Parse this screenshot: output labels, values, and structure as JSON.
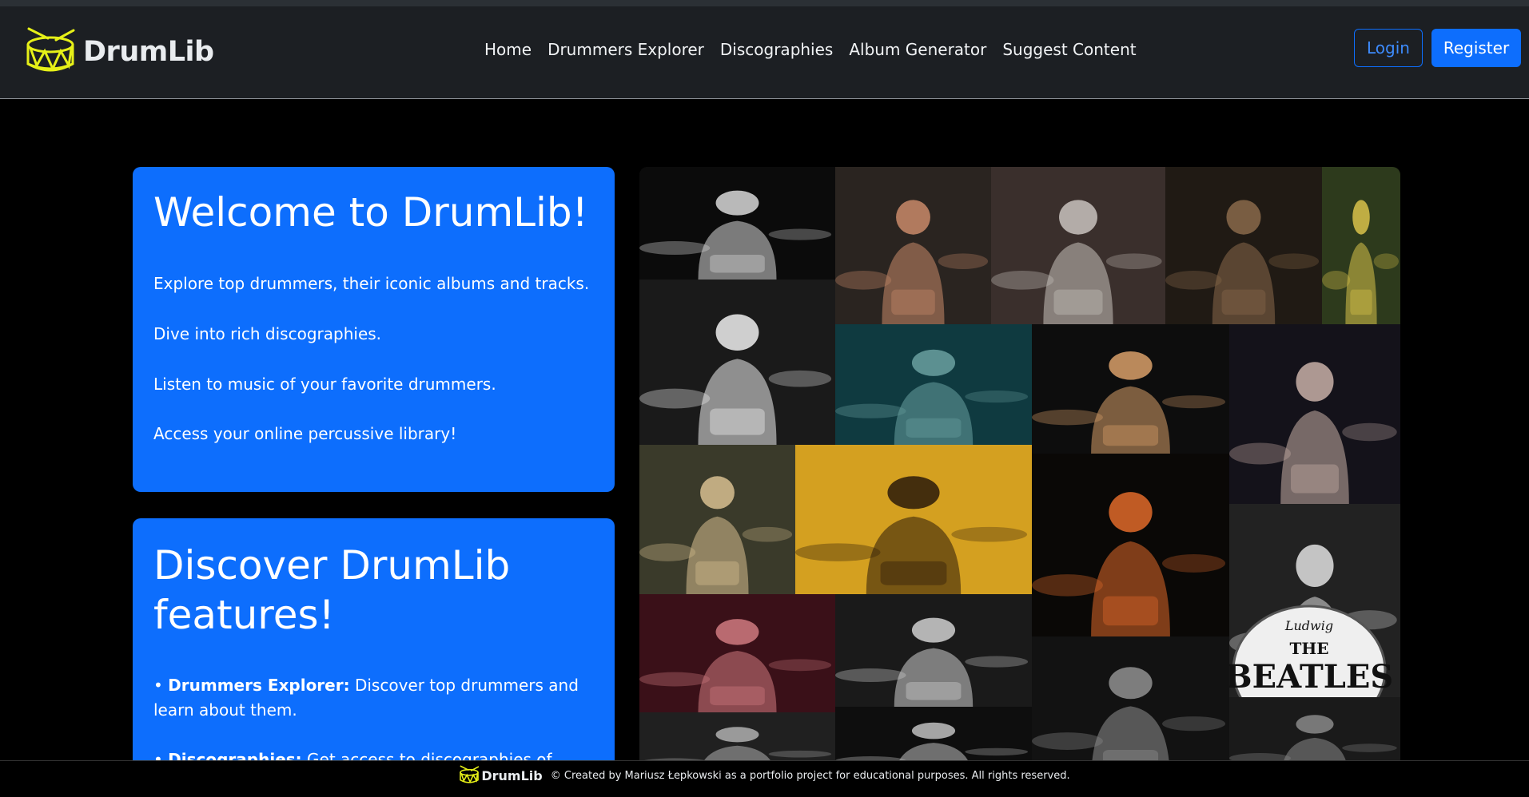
{
  "brand": {
    "name": "DrumLib",
    "logo_icon": "drum-icon",
    "logo_color": "#e6f018"
  },
  "nav": {
    "links": [
      "Home",
      "Drummers Explorer",
      "Discographies",
      "Album Generator",
      "Suggest Content"
    ],
    "login_label": "Login",
    "register_label": "Register"
  },
  "welcome": {
    "title": "Welcome to DrumLib!",
    "lines": [
      "Explore top drummers, their iconic albums and tracks.",
      "Dive into rich discographies.",
      "Listen to music of your favorite drummers.",
      "Access your online percussive library!"
    ]
  },
  "features": {
    "title_line1": "Discover DrumLib",
    "title_line2": "features!",
    "items": [
      {
        "bullet": "•",
        "name": "Drummers Explorer:",
        "text": "Discover top drummers and learn about them."
      },
      {
        "bullet": "•",
        "name": "Discographies:",
        "text": "Get access to discographies of world's"
      }
    ]
  },
  "collage": {
    "alt": "Collage of famous drummers",
    "tiles": [
      {
        "name": "drummer-photo-1",
        "bg": "#0b0b0b",
        "fg": "#d8d8d8"
      },
      {
        "name": "drummer-photo-2",
        "bg": "#2a2420",
        "fg": "#c98a6a"
      },
      {
        "name": "drummer-photo-3",
        "bg": "#3a2f2c",
        "fg": "#c9c2be"
      },
      {
        "name": "drummer-photo-4",
        "bg": "#201a14",
        "fg": "#8a6a4a"
      },
      {
        "name": "drummer-photo-5",
        "bg": "#2d3a1c",
        "fg": "#d9c24a"
      },
      {
        "name": "drummer-photo-6",
        "bg": "#1a1a1a",
        "fg": "#f0f0f0"
      },
      {
        "name": "drummer-photo-7",
        "bg": "#0f3a40",
        "fg": "#6aa0a0"
      },
      {
        "name": "drummer-photo-8",
        "bg": "#0d0d0d",
        "fg": "#d9a06a"
      },
      {
        "name": "drummer-photo-9",
        "bg": "#14121a",
        "fg": "#c8b0a8"
      },
      {
        "name": "drummer-photo-10",
        "bg": "#3a3a2a",
        "fg": "#d8c090"
      },
      {
        "name": "drummer-photo-11",
        "bg": "#d4a020",
        "fg": "#2a1a0a"
      },
      {
        "name": "drummer-photo-12",
        "bg": "#0a0806",
        "fg": "#e06a2a"
      },
      {
        "name": "drummer-photo-13",
        "bg": "#222222",
        "fg": "#e0e0e0"
      },
      {
        "name": "drummer-photo-14",
        "bg": "#3a1018",
        "fg": "#d07a80"
      },
      {
        "name": "drummer-photo-15",
        "bg": "#1a1a1a",
        "fg": "#d0d0d0"
      },
      {
        "name": "drummer-photo-16",
        "bg": "#121212",
        "fg": "#909090"
      },
      {
        "name": "drummer-photo-17",
        "bg": "#202020",
        "fg": "#b0b0b0"
      },
      {
        "name": "drummer-photo-18",
        "bg": "#0e0e0e",
        "fg": "#c0c0c0"
      },
      {
        "name": "drummer-photo-19",
        "bg": "#1a1a1a",
        "fg": "#8a8a8a"
      }
    ],
    "beatles_logo_text_small": "THE",
    "beatles_logo_text": "BEATLES",
    "ludwig_text": "Ludwig"
  },
  "footer": {
    "brand_name": "DrumLib",
    "text": "© Created by Mariusz Łepkowski as a portfolio project for educational purposes. All rights reserved."
  },
  "colors": {
    "primary": "#0d6efd",
    "navbar": "#1c1f23",
    "background": "#000000"
  }
}
